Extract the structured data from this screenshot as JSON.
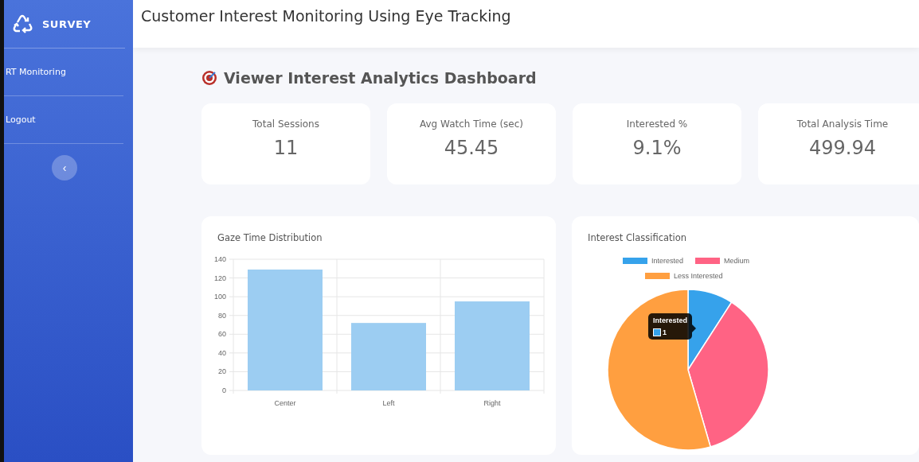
{
  "sidebar": {
    "brand": "SURVEY",
    "items": [
      {
        "label": "RT Monitoring"
      },
      {
        "label": "Logout"
      }
    ],
    "collapse_button": "‹"
  },
  "header": {
    "title": "Customer Interest Monitoring Using Eye Tracking"
  },
  "dashboard": {
    "title": "Viewer Interest Analytics Dashboard",
    "stats": [
      {
        "label": "Total Sessions",
        "value": "11"
      },
      {
        "label": "Avg Watch Time (sec)",
        "value": "45.45"
      },
      {
        "label": "Interested %",
        "value": "9.1%"
      },
      {
        "label": "Total Analysis Time",
        "value": "499.94"
      }
    ],
    "gaze_chart": {
      "chart_data": {
        "type": "bar",
        "title": "Gaze Time Distribution",
        "categories": [
          "Center",
          "Left",
          "Right"
        ],
        "values": [
          129,
          72,
          95
        ],
        "grid": true,
        "ylim": [
          0,
          140
        ],
        "yticks": [
          0,
          20,
          40,
          60,
          80,
          100,
          120,
          140
        ]
      }
    },
    "interest_chart": {
      "chart_data": {
        "type": "pie",
        "title": "Interest Classification",
        "categories": [
          "Interested",
          "Medium",
          "Less Interested"
        ],
        "values": [
          9.1,
          36.4,
          54.5
        ],
        "legend": true,
        "colors": [
          "#36a2eb",
          "#ff6384",
          "#ff9f40"
        ]
      },
      "tooltip": {
        "title": "Interested",
        "value": "1"
      }
    }
  }
}
